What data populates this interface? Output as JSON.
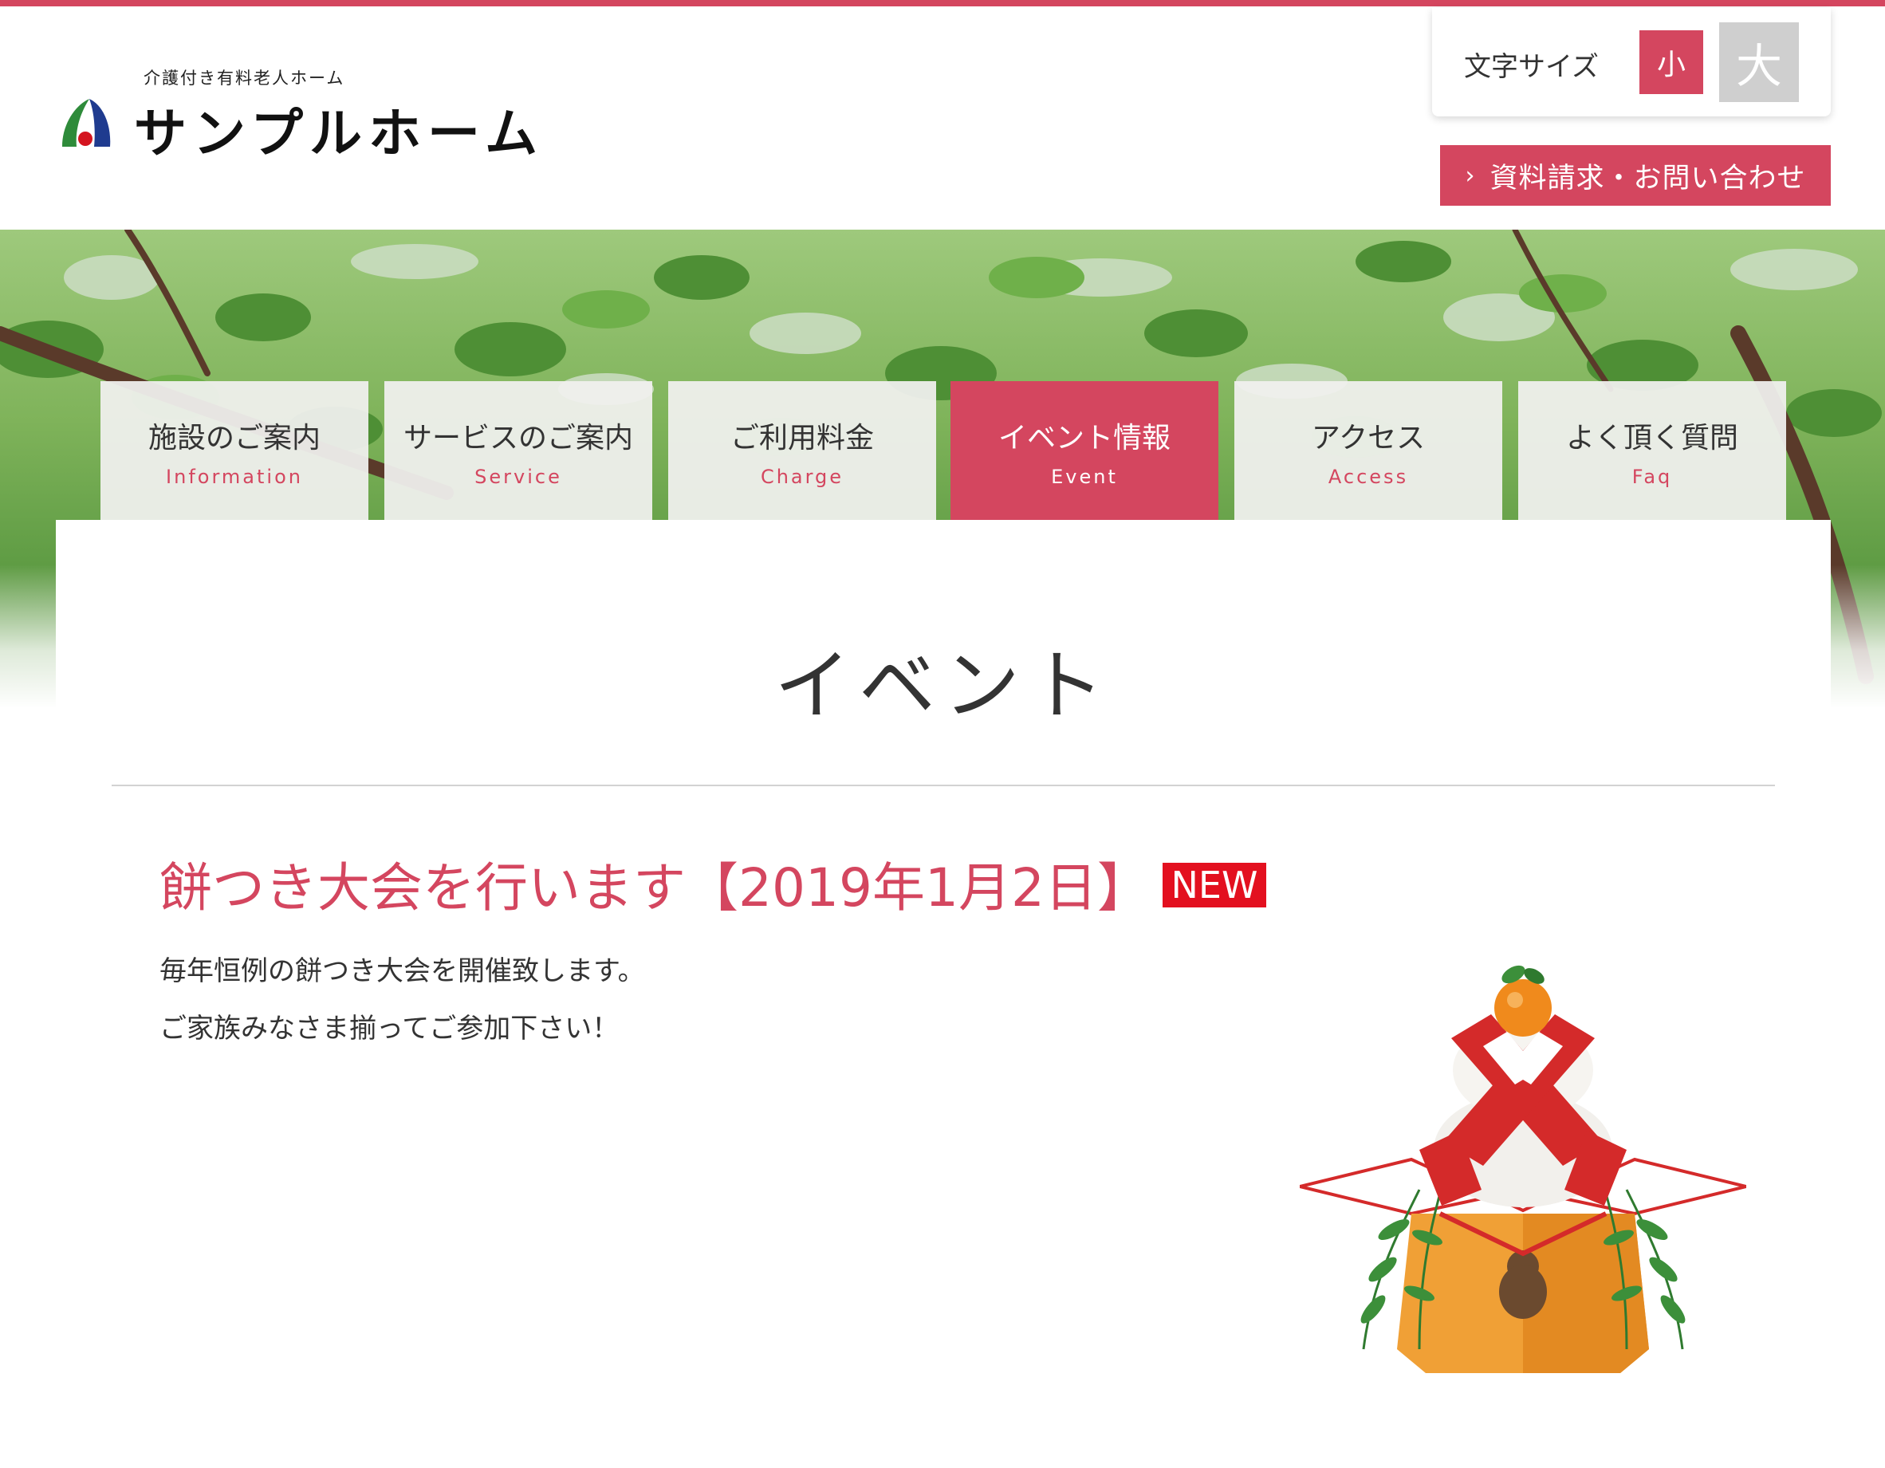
{
  "header": {
    "logo_subtitle": "介護付き有料老人ホーム",
    "logo_name": "サンプルホーム",
    "font_size_label": "文字サイズ",
    "font_size_small": "小",
    "font_size_large": "大",
    "contact_button": "資料請求・お問い合わせ"
  },
  "nav": [
    {
      "label": "施設のご案内",
      "sub": "Information",
      "active": false
    },
    {
      "label": "サービスのご案内",
      "sub": "Service",
      "active": false
    },
    {
      "label": "ご利用料金",
      "sub": "Charge",
      "active": false
    },
    {
      "label": "イベント情報",
      "sub": "Event",
      "active": true
    },
    {
      "label": "アクセス",
      "sub": "Access",
      "active": false
    },
    {
      "label": "よく頂く質問",
      "sub": "Faq",
      "active": false
    }
  ],
  "main": {
    "page_title": "イベント",
    "event": {
      "title": "餅つき大会を行います【2019年1月2日】",
      "badge": "NEW",
      "body": [
        "毎年恒例の餅つき大会を開催致します。",
        "ご家族みなさま揃ってご参加下さい！"
      ]
    }
  },
  "colors": {
    "accent": "#d4465f",
    "badge": "#e3101f",
    "inactive_button": "#cfcfcf"
  },
  "icons": {
    "chevron": "chevron-right-icon",
    "illustration": "kagami-mochi-illustration"
  }
}
